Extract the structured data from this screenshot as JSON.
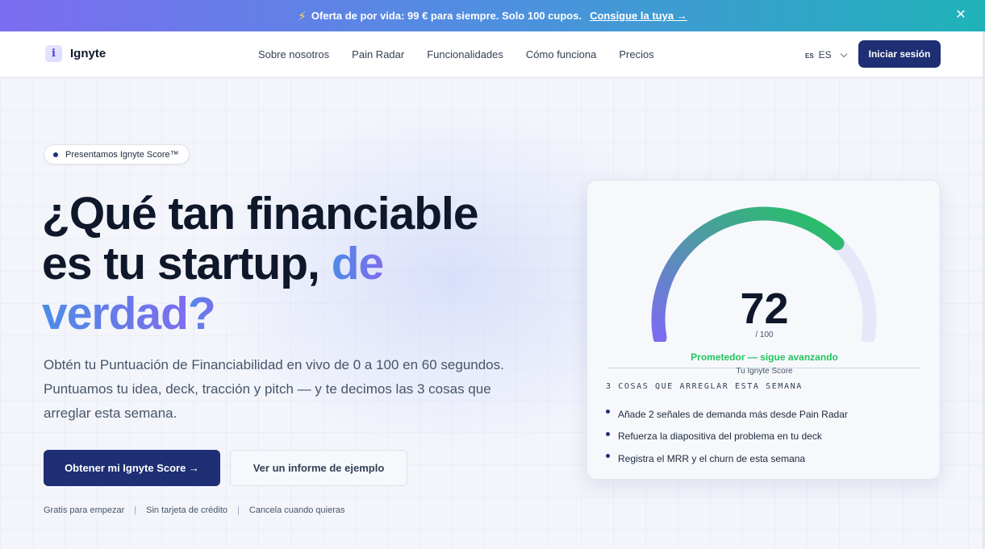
{
  "announcement": {
    "icon": "lightning-icon",
    "text": "Oferta de por vida: 99 € para siempre. Solo 100 cupos.",
    "cta": "Consigue la tuya →",
    "close": "✕"
  },
  "header": {
    "logo_mark": "i",
    "logo": "Ignyte",
    "nav": [
      "Sobre nosotros",
      "Pain Radar",
      "Funcionalidades",
      "Cómo funciona",
      "Precios"
    ],
    "lang_flag": "ES",
    "lang_code": "ES",
    "login": "Iniciar sesión"
  },
  "hero": {
    "pill": "Presentamos Ignyte Score™",
    "headline_1": "¿Qué tan financiable",
    "headline_2": "es tu startup, ",
    "headline_accent_1": "de",
    "headline_accent_2": "verdad",
    "headline_end": "?",
    "sub": "Obtén tu Puntuación de Financiabilidad en vivo de 0 a 100 en 60 segundos. Puntuamos tu idea, deck, tracción y pitch — y te decimos las 3 cosas que arreglar esta semana.",
    "primary_cta": "Obtener mi Ignyte Score →",
    "secondary_cta": "Ver un informe de ejemplo",
    "perks": [
      "Gratis para empezar",
      "Sin tarjeta de crédito",
      "Cancela cuando quieras"
    ],
    "perk_sep": "|"
  },
  "score_card": {
    "score": 72,
    "score_max": "/ 100",
    "fraction": 0.72,
    "verdict": "Prometedor — sigue avanzando",
    "label": "Tu Ignyte Score",
    "fixes_title": "3 COSAS QUE ARREGLAR ESTA SEMANA",
    "fixes": [
      "Añade 2 señales de demanda más desde Pain Radar",
      "Refuerza la diapositiva del problema en tu deck",
      "Registra el MRR y el churn de esta semana"
    ],
    "colors": {
      "gauge_start": "#7c6cf0",
      "gauge_end": "#22c55e",
      "track": "#e6e8fa",
      "verdict": "#22c55e"
    }
  }
}
